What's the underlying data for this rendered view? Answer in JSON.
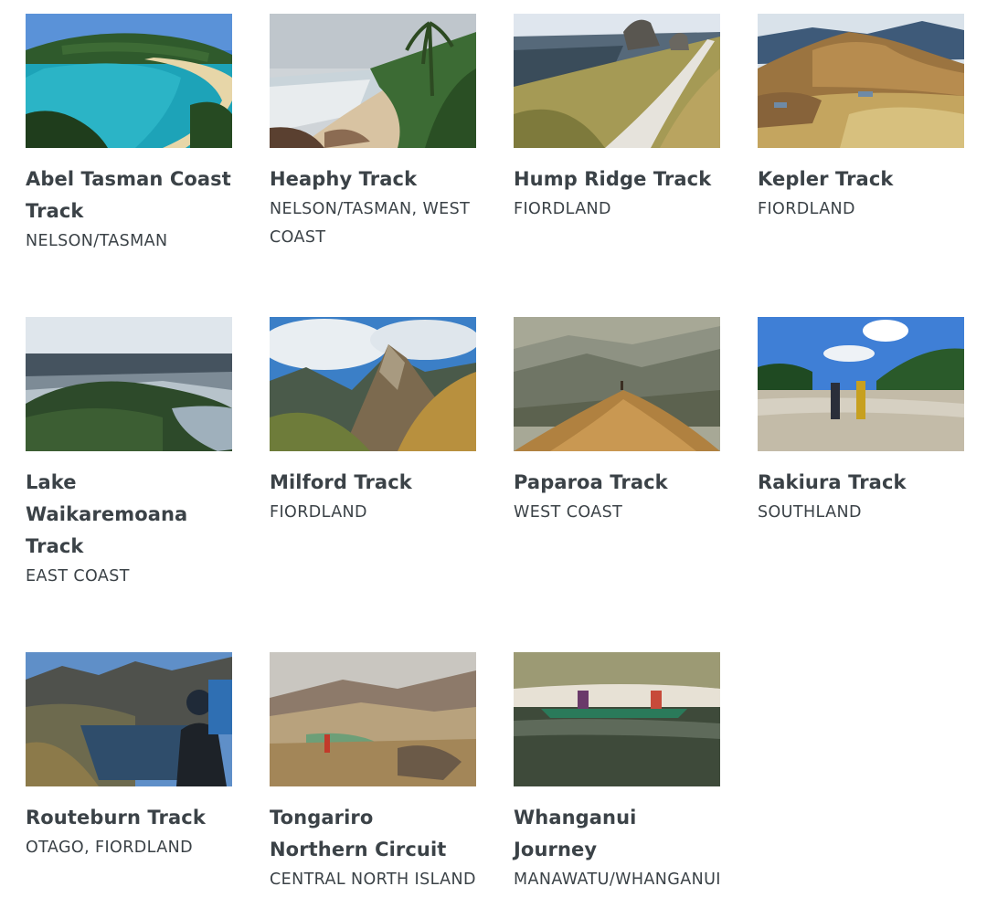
{
  "tracks": [
    {
      "name": "Abel Tasman Coast Track",
      "region": "NELSON/TASMAN",
      "image": "coastal-bay-photo"
    },
    {
      "name": "Heaphy Track",
      "region": "NELSON/TASMAN, WEST COAST",
      "image": "beach-nikau-palms-photo"
    },
    {
      "name": "Hump Ridge Track",
      "region": "FIORDLAND",
      "image": "boardwalk-ridge-photo"
    },
    {
      "name": "Kepler Track",
      "region": "FIORDLAND",
      "image": "alpine-tussock-photo"
    },
    {
      "name": "Lake Waikaremoana Track",
      "region": "EAST COAST",
      "image": "lake-forest-ridges-photo"
    },
    {
      "name": "Milford Track",
      "region": "FIORDLAND",
      "image": "mountain-peak-photo"
    },
    {
      "name": "Paparoa Track",
      "region": "WEST COAST",
      "image": "misty-range-photo"
    },
    {
      "name": "Rakiura Track",
      "region": "SOUTHLAND",
      "image": "tidal-flat-trampers-photo"
    },
    {
      "name": "Routeburn Track",
      "region": "OTAGO, FIORDLAND",
      "image": "hiker-alpine-lake-photo"
    },
    {
      "name": "Tongariro Northern Circuit",
      "region": "CENTRAL NORTH ISLAND",
      "image": "volcanic-crater-photo"
    },
    {
      "name": "Whanganui Journey",
      "region": "MANAWATU/WHANGANUI",
      "image": "river-canoe-photo"
    }
  ]
}
